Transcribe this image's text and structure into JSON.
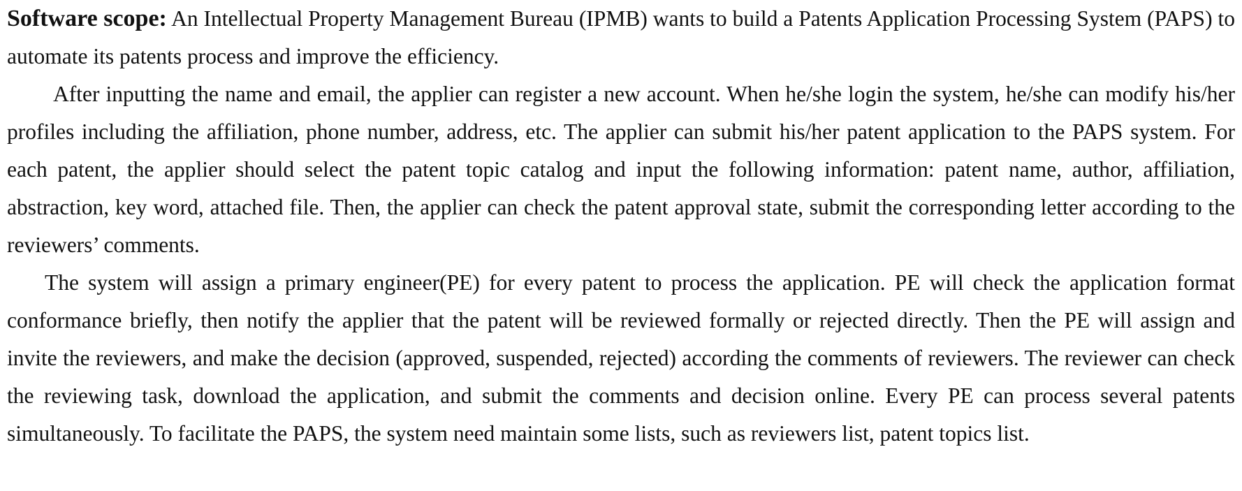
{
  "document": {
    "scope_label": "Software scope:",
    "scope_text": "An Intellectual Property Management Bureau (IPMB) wants to build a Patents Application Processing System (PAPS) to automate its patents process and improve the efficiency.",
    "paragraph_2": "After inputting the name and email, the applier can register a new account. When he/she login the system, he/she can modify his/her profiles including the affiliation, phone number, address, etc. The applier can submit his/her patent application to the PAPS system. For each patent, the applier should select the patent topic catalog and input the following information: patent name, author, affiliation, abstraction, key word, attached file. Then, the applier can check the patent approval state, submit the corresponding letter according to the reviewers’ comments.",
    "paragraph_3": "The system will assign a primary engineer(PE) for every patent to process the application. PE will check the application format conformance briefly, then notify the applier that the patent will be reviewed formally or rejected directly. Then the PE will assign and invite the reviewers, and make the decision (approved, suspended, rejected) according the comments of reviewers. The reviewer can check the reviewing task, download the application, and submit the comments and decision online. Every PE can process several patents simultaneously. To facilitate the PAPS, the system need maintain some lists, such as reviewers list, patent topics list."
  }
}
